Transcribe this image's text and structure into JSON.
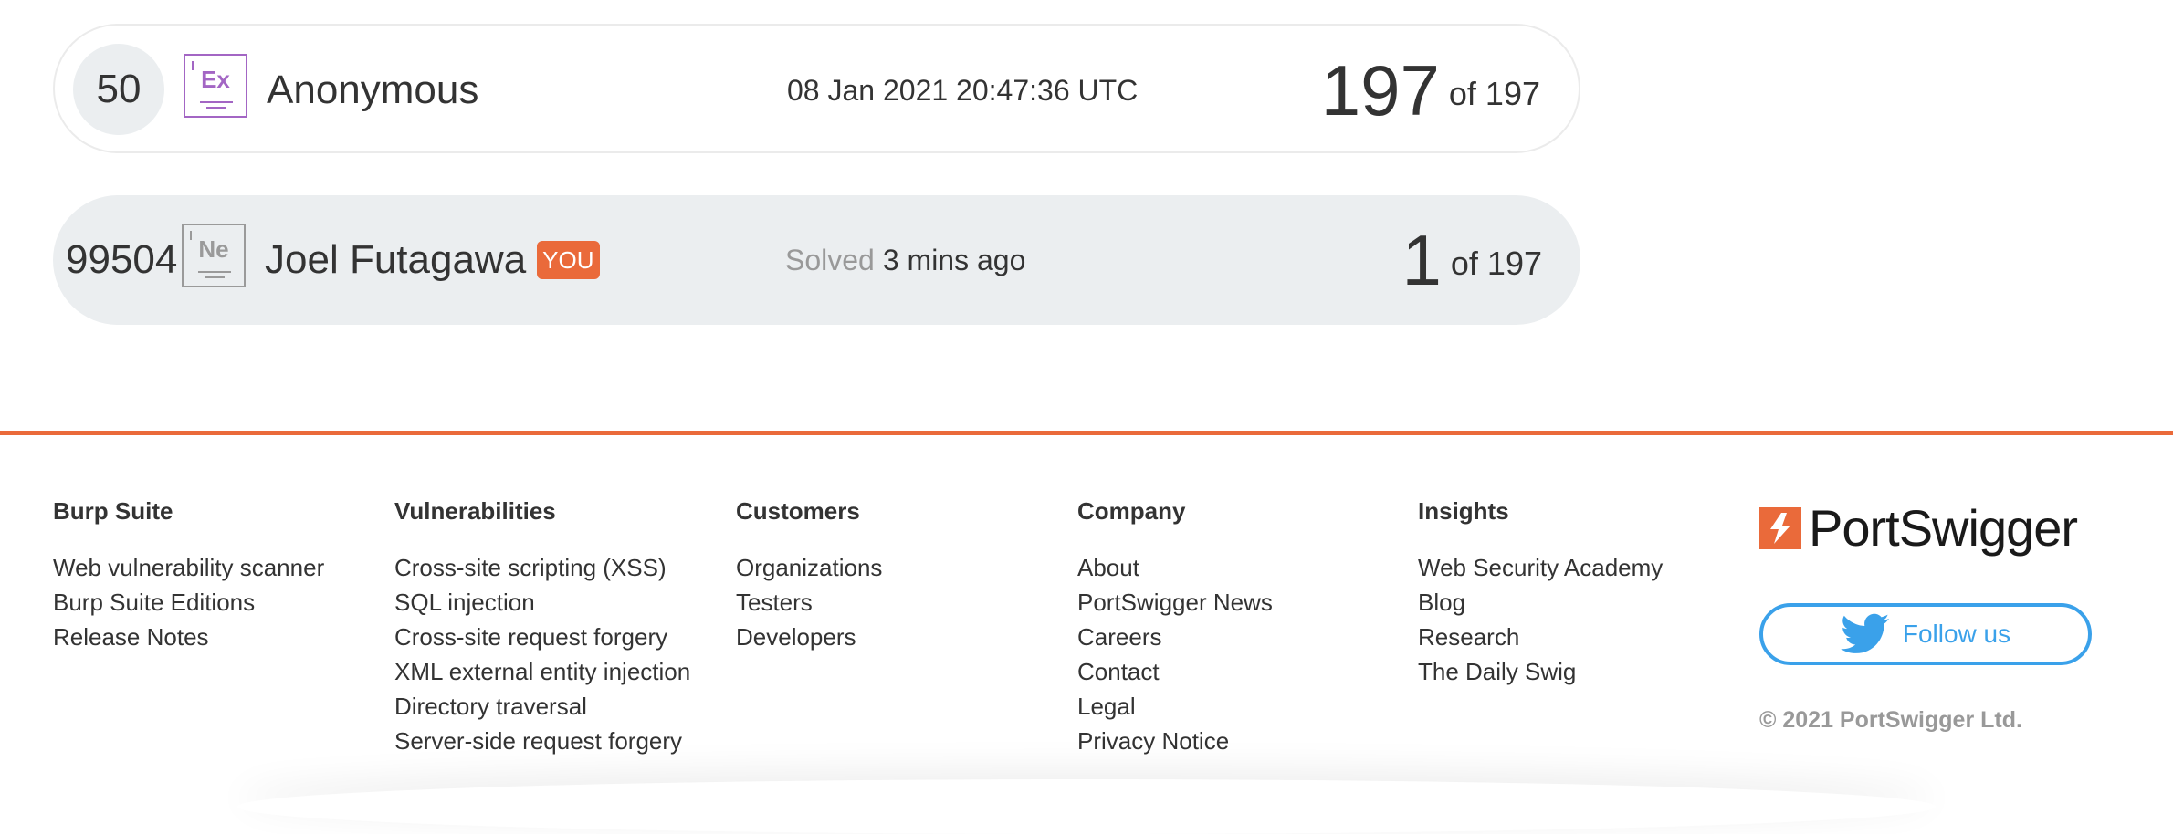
{
  "leaderboard": {
    "rows": [
      {
        "rank": "50",
        "badge_symbol": "Ex",
        "name": "Anonymous",
        "timestamp": "08 Jan 2021 20:47:36 UTC",
        "score": "197",
        "of_total": "of 197"
      },
      {
        "rank": "99504",
        "badge_symbol": "Ne",
        "name": "Joel Futagawa",
        "you_tag": "YOU",
        "status_prefix": "Solved",
        "status_time": "3 mins ago",
        "score": "1",
        "of_total": "of 197"
      }
    ]
  },
  "colors": {
    "accent": "#ea6a3a",
    "expert_badge": "#a366c4",
    "twitter": "#3aa1ea",
    "row_bg": "#ebeef0"
  },
  "footer": {
    "columns": [
      {
        "heading": "Burp Suite",
        "links": [
          "Web vulnerability scanner",
          "Burp Suite Editions",
          "Release Notes"
        ]
      },
      {
        "heading": "Vulnerabilities",
        "links": [
          "Cross-site scripting (XSS)",
          "SQL injection",
          "Cross-site request forgery",
          "XML external entity injection",
          "Directory traversal",
          "Server-side request forgery"
        ]
      },
      {
        "heading": "Customers",
        "links": [
          "Organizations",
          "Testers",
          "Developers"
        ]
      },
      {
        "heading": "Company",
        "links": [
          "About",
          "PortSwigger News",
          "Careers",
          "Contact",
          "Legal",
          "Privacy Notice"
        ]
      },
      {
        "heading": "Insights",
        "links": [
          "Web Security Academy",
          "Blog",
          "Research",
          "The Daily Swig"
        ]
      }
    ],
    "brand_name": "PortSwigger",
    "follow_label": "Follow us",
    "follow_icon": "twitter-bird-icon",
    "copyright": "© 2021 PortSwigger Ltd."
  }
}
